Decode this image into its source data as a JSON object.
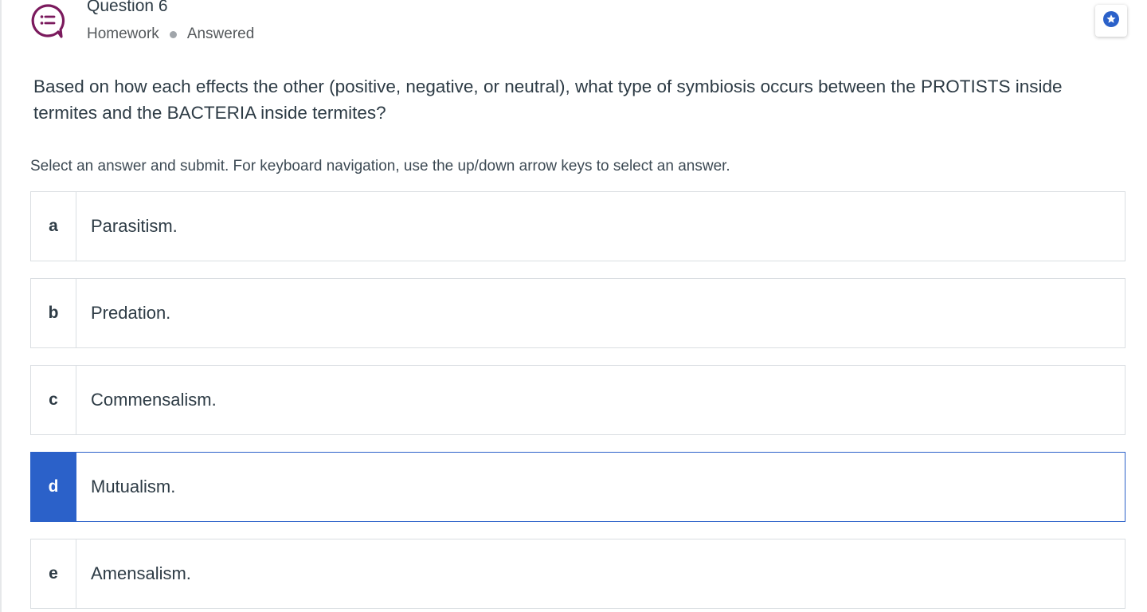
{
  "header": {
    "title": "Question 6",
    "category": "Homework",
    "status": "Answered"
  },
  "question": {
    "prompt": "Based on how each effects the other (positive, negative, or neutral), what type of symbiosis occurs between the PROTISTS inside termites and the BACTERIA inside termites?",
    "instructions": "Select an answer and submit. For keyboard navigation, use the up/down arrow keys to select an answer."
  },
  "options": [
    {
      "letter": "a",
      "text": "Parasitism."
    },
    {
      "letter": "b",
      "text": "Predation."
    },
    {
      "letter": "c",
      "text": "Commensalism."
    },
    {
      "letter": "d",
      "text": "Mutualism."
    },
    {
      "letter": "e",
      "text": "Amensalism."
    }
  ],
  "selected_option": "d",
  "colors": {
    "accent": "#2b61c9",
    "icon": "#7b1a5d",
    "border": "#dadee2"
  }
}
